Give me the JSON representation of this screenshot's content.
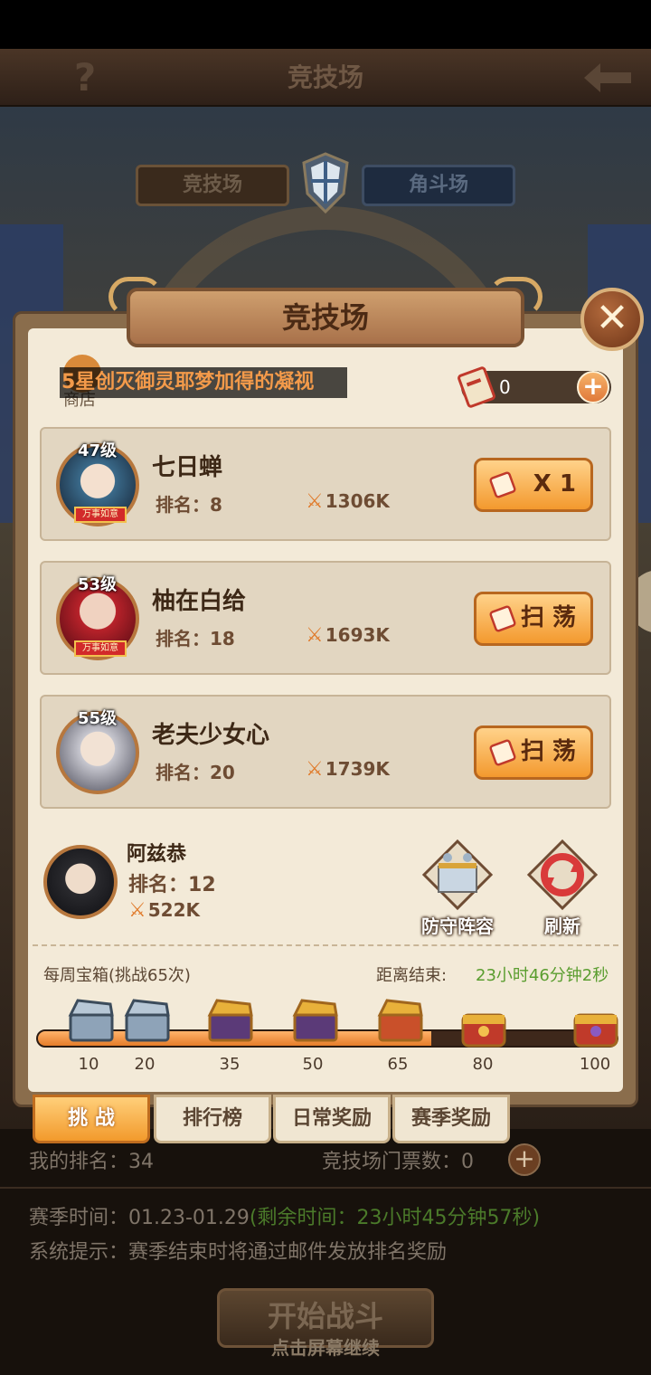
{
  "header": {
    "help_icon": "?",
    "title": "竞技场"
  },
  "mode_tabs": [
    {
      "label": "竞技场"
    },
    {
      "label": "角斗场"
    }
  ],
  "dialog": {
    "title": "竞技场",
    "close_icon": "✕",
    "shop_label": "商店",
    "marquee": "5星创灭御灵耶梦加得的凝视",
    "ticket_count": "0",
    "ticket_plus": "+"
  },
  "opponents": [
    {
      "level": "47级",
      "name": "七日蝉",
      "rank_label": "排名：",
      "rank": "8",
      "power": "1306K",
      "action": "X 1",
      "tag": "万事如意"
    },
    {
      "level": "53级",
      "name": "柚在白给",
      "rank_label": "排名：",
      "rank": "18",
      "power": "1693K",
      "action": "扫 荡",
      "tag": "万事如意"
    },
    {
      "level": "55级",
      "name": "老夫少女心",
      "rank_label": "排名：",
      "rank": "20",
      "power": "1739K",
      "action": "扫 荡"
    }
  ],
  "me": {
    "name": "阿兹恭",
    "rank_label": "排名：",
    "rank": "12",
    "power": "522K"
  },
  "tools": {
    "defense_label": "防守阵容",
    "refresh_label": "刷新"
  },
  "weekly": {
    "label": "每周宝箱(挑战65次)",
    "countdown_label": "距离结束:",
    "countdown_value": "23小时46分钟2秒",
    "progress": 0.68,
    "milestones": [
      "10",
      "20",
      "35",
      "50",
      "65",
      "80",
      "100"
    ]
  },
  "tabs": [
    {
      "label": "挑 战"
    },
    {
      "label": "排行榜"
    },
    {
      "label": "日常奖励"
    },
    {
      "label": "赛季奖励"
    }
  ],
  "under": {
    "my_rank": "我的排名：34",
    "tickets": "竞技场门票数：0",
    "season": "赛季时间：01.23-01.29",
    "season_remain": "(剩余时间：23小时45分钟57秒)",
    "system": "系统提示：赛季结束时将通过邮件发放排名奖励",
    "start_button": "开始战斗",
    "tap_hint": "点击屏幕继续"
  },
  "colors": {
    "accent": "#f29a2c",
    "countdown": "#5a9d2f",
    "panel": "#f3ead8"
  }
}
